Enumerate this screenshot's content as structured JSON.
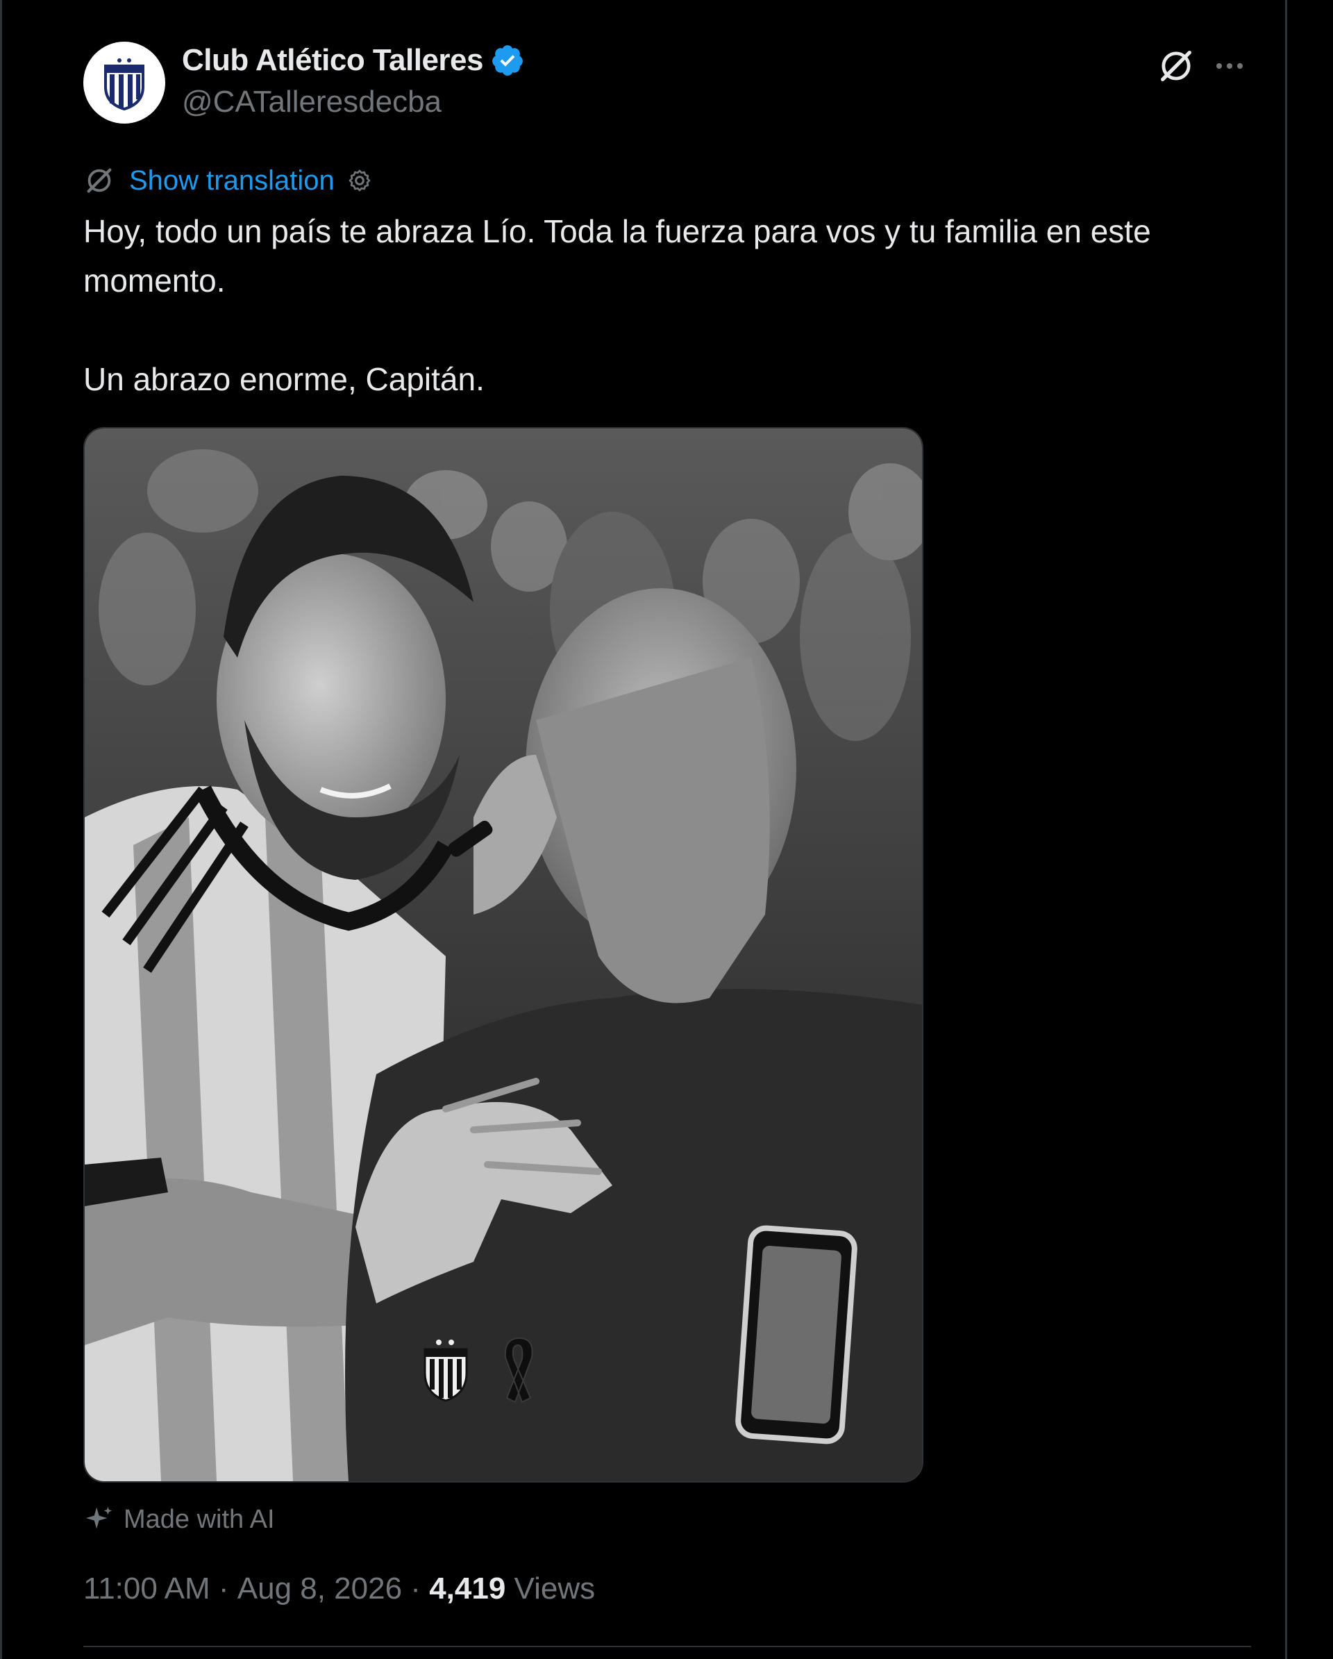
{
  "author": {
    "display_name": "Club Atlético Talleres",
    "handle": "@CATalleresdecba",
    "verified": true,
    "avatar_icon": "talleres-crest-icon"
  },
  "header_actions": {
    "grok_icon": "grok-icon",
    "more_icon": "more-horizontal-icon"
  },
  "translation": {
    "label": "Show translation",
    "icon": "translate-icon",
    "settings_icon": "gear-icon"
  },
  "tweet": {
    "lines": [
      "Hoy, todo un país te abraza Lío. Toda la fuerza para vos y tu familia en este momento.",
      "Un abrazo enorme, Capitán."
    ]
  },
  "media": {
    "type": "photo",
    "style": "black-and-white",
    "overlay_icons": [
      "talleres-crest-icon",
      "mourning-ribbon-icon"
    ]
  },
  "ai_badge": {
    "label": "Made with AI",
    "icon": "sparkle-icon"
  },
  "meta": {
    "time": "11:00 AM",
    "separator": " · ",
    "date": "Aug 8, 2026",
    "views_count": "4,419",
    "views_label": "Views"
  },
  "colors": {
    "background": "#000000",
    "text": "#e7e9ea",
    "muted": "#71767b",
    "accent": "#1d9bf0",
    "border": "#2f3336"
  }
}
